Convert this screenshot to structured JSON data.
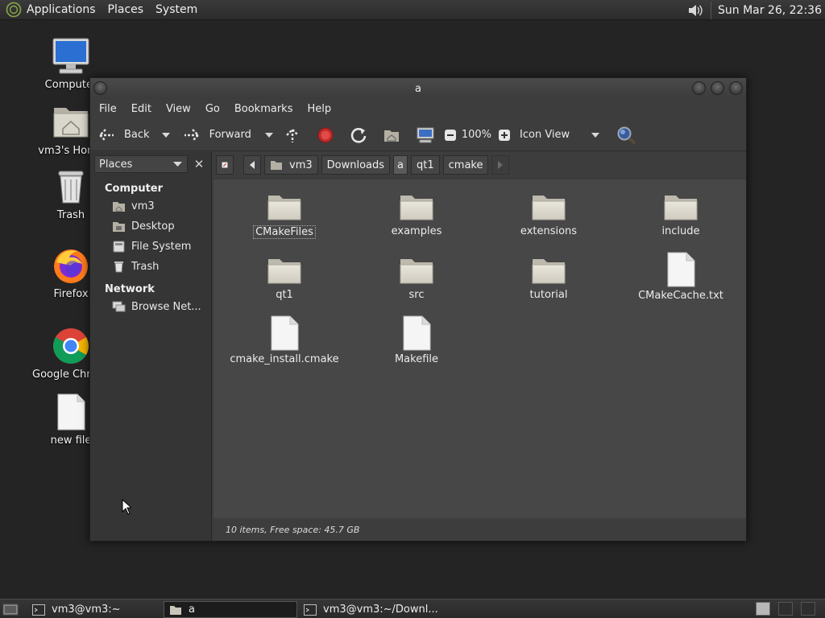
{
  "top_panel": {
    "menu": [
      "Applications",
      "Places",
      "System"
    ],
    "clock": "Sun Mar 26, 22:36"
  },
  "desktop_icons": [
    {
      "label": "Computer",
      "icon": "computer-icon"
    },
    {
      "label": "vm3's Home",
      "icon": "home-folder-icon"
    },
    {
      "label": "Trash",
      "icon": "trash-icon"
    },
    {
      "label": "Firefox",
      "icon": "firefox-icon"
    },
    {
      "label": "Google Chrome",
      "icon": "chrome-icon"
    },
    {
      "label": "new file",
      "icon": "file-icon"
    }
  ],
  "window": {
    "title": "a",
    "menubar": [
      "File",
      "Edit",
      "View",
      "Go",
      "Bookmarks",
      "Help"
    ],
    "toolbar": {
      "back": "Back",
      "forward": "Forward",
      "zoom": "100%",
      "view_mode": "Icon View"
    },
    "sidebar": {
      "selector": "Places",
      "groups": [
        {
          "title": "Computer",
          "items": [
            "vm3",
            "Desktop",
            "File System",
            "Trash"
          ]
        },
        {
          "title": "Network",
          "items": [
            "Browse Net..."
          ]
        }
      ]
    },
    "path": [
      "vm3",
      "Downloads",
      "a",
      "qt1",
      "cmake"
    ],
    "files": [
      {
        "name": "CMakeFiles",
        "type": "folder",
        "selected": true
      },
      {
        "name": "examples",
        "type": "folder"
      },
      {
        "name": "extensions",
        "type": "folder"
      },
      {
        "name": "include",
        "type": "folder"
      },
      {
        "name": "qt1",
        "type": "folder"
      },
      {
        "name": "src",
        "type": "folder"
      },
      {
        "name": "tutorial",
        "type": "folder"
      },
      {
        "name": "CMakeCache.txt",
        "type": "file"
      },
      {
        "name": "cmake_install.cmake",
        "type": "file"
      },
      {
        "name": "Makefile",
        "type": "file"
      }
    ],
    "status": "10 items, Free space: 45.7 GB"
  },
  "taskbar": [
    {
      "label": "vm3@vm3:~",
      "icon": "terminal-icon",
      "active": false
    },
    {
      "label": "a",
      "icon": "folder-icon",
      "active": true
    },
    {
      "label": "vm3@vm3:~/Downl...",
      "icon": "terminal-icon",
      "active": false
    }
  ]
}
